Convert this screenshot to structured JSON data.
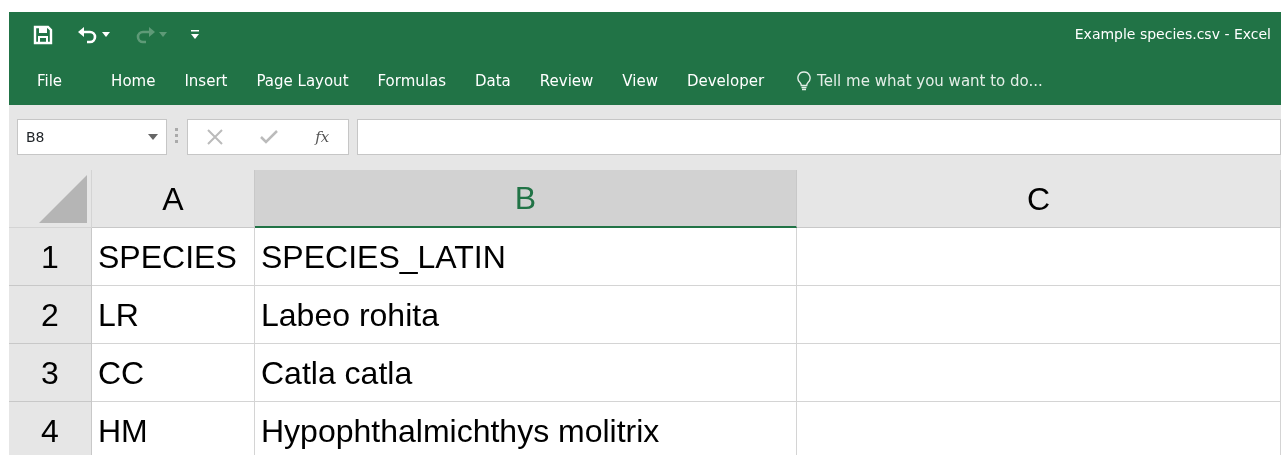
{
  "window": {
    "title": "Example species.csv - Excel"
  },
  "quick_access": [
    {
      "kind": "save",
      "disabled": false
    },
    {
      "kind": "undo",
      "disabled": false
    },
    {
      "kind": "redo",
      "disabled": true
    },
    {
      "kind": "customize",
      "disabled": false
    }
  ],
  "ribbon_tabs": [
    {
      "label": "File"
    },
    {
      "label": "Home"
    },
    {
      "label": "Insert"
    },
    {
      "label": "Page Layout"
    },
    {
      "label": "Formulas"
    },
    {
      "label": "Data"
    },
    {
      "label": "Review"
    },
    {
      "label": "View"
    },
    {
      "label": "Developer"
    }
  ],
  "tell_me": {
    "placeholder": "Tell me what you want to do..."
  },
  "name_box": {
    "value": "B8"
  },
  "formula_bar": {
    "fx": "fx"
  },
  "columns": [
    {
      "label": "A",
      "selected": false
    },
    {
      "label": "B",
      "selected": true
    },
    {
      "label": "C",
      "selected": false
    }
  ],
  "rows": [
    {
      "number": "1",
      "cells": [
        "SPECIES",
        "SPECIES_LATIN",
        ""
      ]
    },
    {
      "number": "2",
      "cells": [
        "LR",
        "Labeo rohita",
        ""
      ]
    },
    {
      "number": "3",
      "cells": [
        "CC",
        "Catla catla",
        ""
      ]
    },
    {
      "number": "4",
      "cells": [
        "HM",
        "Hypophthalmichthys molitrix",
        ""
      ]
    }
  ]
}
